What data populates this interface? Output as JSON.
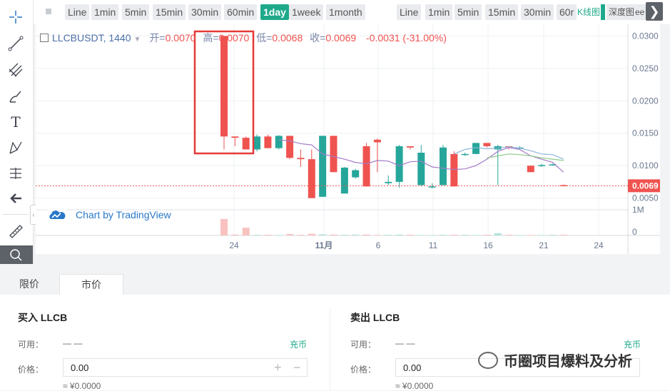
{
  "toolbar": {
    "intervals": [
      "Line",
      "1min",
      "5min",
      "15min",
      "30min",
      "60min",
      "1day",
      "1week",
      "1month"
    ],
    "active_interval": "1day",
    "intervals_right": [
      "Line",
      "1min",
      "5min",
      "15min",
      "30min",
      "60r"
    ],
    "kline_tab": "K线图",
    "depth_tab": "深度图",
    "tab_overflow": "ee",
    "collapse_glyph": "❯"
  },
  "legend": {
    "symbol": "LLCBUSDT, 1440",
    "open_label": "开",
    "open": "0.0070",
    "high_label": "高",
    "high": "0.0070",
    "low_label": "低",
    "low": "0.0068",
    "close_label": "收",
    "close": "0.0069",
    "change": "-0.0031 (-31.00%)"
  },
  "chart_data": {
    "type": "candlestick",
    "price_axis_ticks": [
      "0.0300",
      "0.0250",
      "0.0200",
      "0.0150",
      "0.0100",
      "0.0050"
    ],
    "volume_axis_ticks": [
      "1M",
      "0"
    ],
    "x_ticks": [
      "24",
      "11月",
      "6",
      "11",
      "16",
      "21",
      "24"
    ],
    "last_price": "0.0069",
    "ylim": [
      0.0032,
      0.0318
    ],
    "candles": [
      {
        "o": 0.03,
        "h": 0.03,
        "l": 0.0125,
        "c": 0.0145,
        "vol": 0.72
      },
      {
        "o": 0.0145,
        "h": 0.0145,
        "l": 0.013,
        "c": 0.0143,
        "vol": 0.04
      },
      {
        "o": 0.0143,
        "h": 0.0145,
        "l": 0.0125,
        "c": 0.0125,
        "vol": 0.34
      },
      {
        "o": 0.0125,
        "h": 0.0148,
        "l": 0.0122,
        "c": 0.0145,
        "vol": 0.03
      },
      {
        "o": 0.0145,
        "h": 0.0148,
        "l": 0.0127,
        "c": 0.0127,
        "vol": 0.03
      },
      {
        "o": 0.0127,
        "h": 0.0147,
        "l": 0.0125,
        "c": 0.0146,
        "vol": 0.02
      },
      {
        "o": 0.0146,
        "h": 0.0146,
        "l": 0.011,
        "c": 0.0112,
        "vol": 0.06
      },
      {
        "o": 0.0112,
        "h": 0.0125,
        "l": 0.0098,
        "c": 0.011,
        "vol": 0.03
      },
      {
        "o": 0.011,
        "h": 0.0125,
        "l": 0.005,
        "c": 0.005,
        "vol": 0.07
      },
      {
        "o": 0.0052,
        "h": 0.0146,
        "l": 0.0052,
        "c": 0.0146,
        "vol": 0.05
      },
      {
        "o": 0.0146,
        "h": 0.0146,
        "l": 0.009,
        "c": 0.009,
        "vol": 0.04
      },
      {
        "o": 0.0057,
        "h": 0.0098,
        "l": 0.0057,
        "c": 0.0097,
        "vol": 0.03
      },
      {
        "o": 0.0082,
        "h": 0.0095,
        "l": 0.008,
        "c": 0.0093,
        "vol": 0.04
      },
      {
        "o": 0.013,
        "h": 0.0135,
        "l": 0.0068,
        "c": 0.0068,
        "vol": 0.04
      },
      {
        "o": 0.014,
        "h": 0.0142,
        "l": 0.009,
        "c": 0.0136,
        "vol": 0.02
      },
      {
        "o": 0.0073,
        "h": 0.0085,
        "l": 0.007,
        "c": 0.0075,
        "vol": 0.03
      },
      {
        "o": 0.0075,
        "h": 0.0132,
        "l": 0.0066,
        "c": 0.013,
        "vol": 0.04
      },
      {
        "o": 0.013,
        "h": 0.013,
        "l": 0.0125,
        "c": 0.0128,
        "vol": 0.03
      },
      {
        "o": 0.007,
        "h": 0.0132,
        "l": 0.0068,
        "c": 0.012,
        "vol": 0.02
      },
      {
        "o": 0.0068,
        "h": 0.0073,
        "l": 0.0065,
        "c": 0.0068,
        "vol": 0.02
      },
      {
        "o": 0.007,
        "h": 0.0132,
        "l": 0.007,
        "c": 0.0128,
        "vol": 0.03
      },
      {
        "o": 0.0118,
        "h": 0.0122,
        "l": 0.0068,
        "c": 0.0068,
        "vol": 0.03
      },
      {
        "o": 0.0118,
        "h": 0.012,
        "l": 0.0115,
        "c": 0.0118,
        "vol": 0.03
      },
      {
        "o": 0.0118,
        "h": 0.0135,
        "l": 0.0118,
        "c": 0.0135,
        "vol": 0.02
      },
      {
        "o": 0.0135,
        "h": 0.0135,
        "l": 0.0128,
        "c": 0.013,
        "vol": 0.03
      },
      {
        "o": 0.0125,
        "h": 0.0132,
        "l": 0.007,
        "c": 0.013,
        "vol": 0.1
      },
      {
        "o": 0.013,
        "h": 0.013,
        "l": 0.0125,
        "c": 0.0128,
        "vol": 0.03
      },
      {
        "o": 0.0128,
        "h": 0.013,
        "l": 0.0125,
        "c": 0.0128,
        "vol": 0.02
      },
      {
        "o": 0.01,
        "h": 0.01,
        "l": 0.009,
        "c": 0.009,
        "vol": 0.02
      },
      {
        "o": 0.01,
        "h": 0.0103,
        "l": 0.0098,
        "c": 0.0101,
        "vol": 0.02
      },
      {
        "o": 0.0102,
        "h": 0.0103,
        "l": 0.01,
        "c": 0.0102,
        "vol": 0.03
      },
      {
        "o": 0.007,
        "h": 0.0071,
        "l": 0.0068,
        "c": 0.0069,
        "vol": 0.03
      }
    ],
    "ma_lines": [
      {
        "color": "#a27bc8",
        "values": [
          null,
          null,
          null,
          null,
          null,
          0.014,
          0.0138,
          0.0134,
          0.0132,
          0.0118,
          0.0114,
          0.011,
          0.0105,
          0.0103,
          0.0108,
          0.0107,
          0.01,
          0.0106,
          0.0107,
          0.0098,
          0.0096,
          0.0094,
          0.0095,
          0.01,
          0.011,
          0.0122,
          0.0128,
          0.0125,
          0.0115,
          0.011,
          0.0105,
          0.009
        ]
      },
      {
        "color": "#8fc98a",
        "values": [
          null,
          null,
          null,
          null,
          null,
          null,
          null,
          null,
          null,
          null,
          null,
          null,
          null,
          null,
          null,
          null,
          null,
          null,
          null,
          null,
          null,
          null,
          null,
          null,
          0.0112,
          0.0115,
          0.0118,
          0.0117,
          0.0115,
          0.0112,
          0.011,
          0.0108
        ]
      },
      {
        "color": "#8db5dc",
        "values": [
          null,
          null,
          null,
          null,
          null,
          null,
          null,
          null,
          null,
          null,
          null,
          null,
          null,
          null,
          null,
          null,
          null,
          null,
          null,
          null,
          null,
          0.0118,
          0.0125,
          0.0128,
          0.0126,
          0.0127,
          0.0129,
          0.0127,
          0.0123,
          0.0118,
          0.0117,
          0.011
        ]
      }
    ]
  },
  "watermark": "Chart by TradingView",
  "order_tabs": [
    "限价",
    "市价"
  ],
  "buy": {
    "heading": "买入 LLCB",
    "available_label": "可用：",
    "available_value": "— —",
    "deposit": "充币",
    "price_label": "价格：",
    "price_value": "0.00",
    "approx": "≈ ¥0.0000"
  },
  "sell": {
    "heading": "卖出 LLCB",
    "available_label": "可用：",
    "available_value": "— —",
    "deposit": "充币",
    "price_label": "价格：",
    "price_value": "0.00",
    "approx": "≈ ¥0.0000"
  },
  "wechat_watermark": "币圈项目爆料及分析",
  "colors": {
    "up": "#26a69a",
    "down": "#ef5350",
    "accent": "#1fa98b",
    "highlight_box": "#e53935"
  }
}
